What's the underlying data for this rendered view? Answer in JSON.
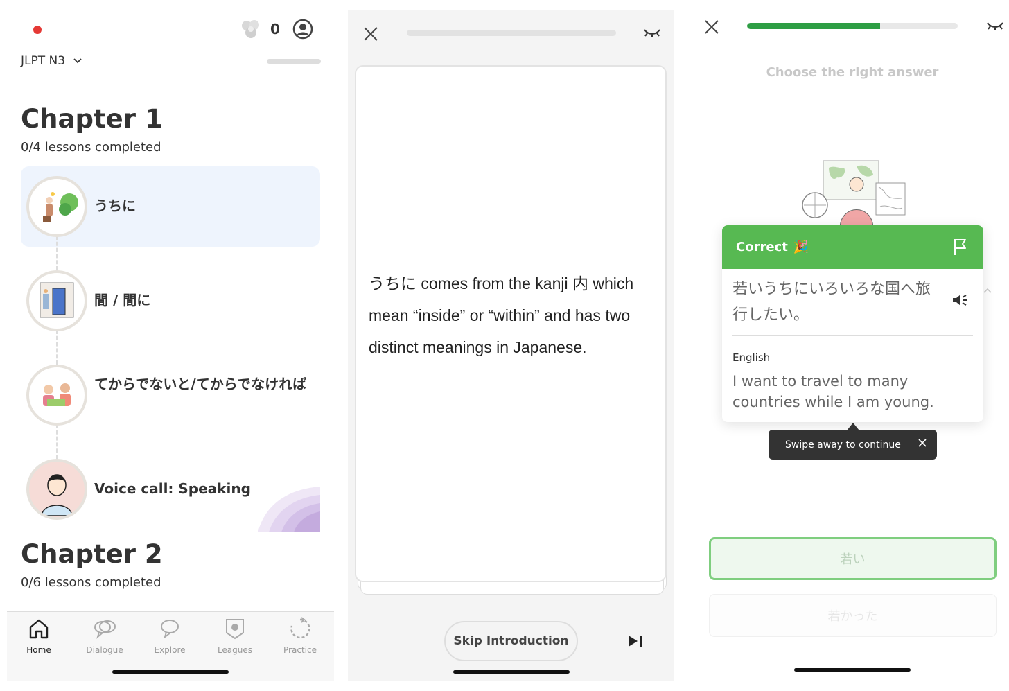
{
  "home": {
    "gem_count": "0",
    "course": "JLPT N3",
    "chapters": [
      {
        "title": "Chapter 1",
        "subtitle": "0/4 lessons completed"
      },
      {
        "title": "Chapter 2",
        "subtitle": "0/6 lessons completed"
      }
    ],
    "lessons": [
      {
        "label": "うちに"
      },
      {
        "label": "間 / 間に"
      },
      {
        "label": "てからでないと/てからでなければ"
      },
      {
        "label": "Voice call: Speaking"
      }
    ],
    "nav": [
      {
        "label": "Home",
        "icon": "home-icon"
      },
      {
        "label": "Dialogue",
        "icon": "dialogue-icon"
      },
      {
        "label": "Explore",
        "icon": "explore-icon"
      },
      {
        "label": "Leagues",
        "icon": "leagues-icon"
      },
      {
        "label": "Practice",
        "icon": "practice-icon"
      }
    ]
  },
  "intro": {
    "card_text": "うちに comes from the kanji 内 which mean “inside” or “within” and has two distinct meanings in Japanese.",
    "skip_label": "Skip Introduction"
  },
  "quiz": {
    "progress": 0.63,
    "prompt": "Choose the right answer",
    "result_title": "Correct",
    "result_emoji": "🎉",
    "japanese_sentence": "若いうちにいろいろな国へ旅行したい。",
    "english_label": "English",
    "english_sentence": "I want to travel to many countries while I am young.",
    "toast": "Swipe away to continue",
    "answers": [
      "若い",
      "若かった"
    ],
    "colors": {
      "correct": "#57b952",
      "progress": "#2e9e44",
      "record": "#e53935"
    }
  }
}
